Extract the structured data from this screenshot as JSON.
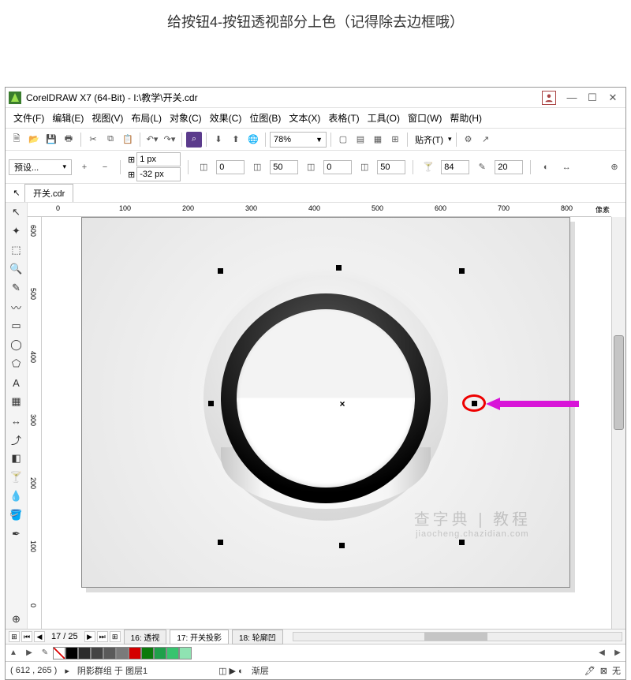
{
  "instruction": "给按钮4-按钮透视部分上色（记得除去边框哦）",
  "titlebar": {
    "app_name": "CorelDRAW X7 (64-Bit)",
    "doc_path": "I:\\教学\\开关.cdr"
  },
  "menus": {
    "file": "文件(F)",
    "edit": "编辑(E)",
    "view": "视图(V)",
    "layout": "布局(L)",
    "object": "对象(C)",
    "effects": "效果(C)",
    "bitmaps": "位图(B)",
    "text": "文本(X)",
    "table": "表格(T)",
    "tools": "工具(O)",
    "window": "窗口(W)",
    "help": "帮助(H)"
  },
  "toolbar": {
    "zoom_value": "78%",
    "snap_label": "贴齐(T)"
  },
  "propbar": {
    "preset_label": "预设...",
    "x_value": "1 px",
    "y_value": "-32 px",
    "w_value": "0",
    "h_value": "0",
    "sx_value": "50",
    "sy_value": "50",
    "val_a": "84",
    "val_b": "20"
  },
  "doc_tab": {
    "name": "开关.cdr"
  },
  "ruler": {
    "h_ticks": [
      "0",
      "100",
      "200",
      "300",
      "400",
      "500",
      "600",
      "700",
      "800"
    ],
    "v_ticks": [
      "600",
      "500",
      "400",
      "300",
      "200",
      "100",
      "0"
    ],
    "unit": "像素"
  },
  "page_nav": {
    "counter": "17 / 25",
    "tab16": "16: 透视",
    "tab17": "17: 开关投影",
    "tab18": "18: 轮廓凹"
  },
  "status": {
    "coords": "( 612 , 265 )",
    "object_info": "阴影群组 于 图层1",
    "hint": "渐层",
    "stroke_label": "无"
  },
  "watermark": {
    "main": "查字典 | 教程",
    "sub": "jiaocheng.chazidian.com"
  },
  "palette": [
    "#000000",
    "#2b2b2b",
    "#444444",
    "#5a5a5a",
    "#7a7a7a",
    "#d40000",
    "#0b7a0b",
    "#1fa04a",
    "#37c46e",
    "#8fe3b2"
  ]
}
